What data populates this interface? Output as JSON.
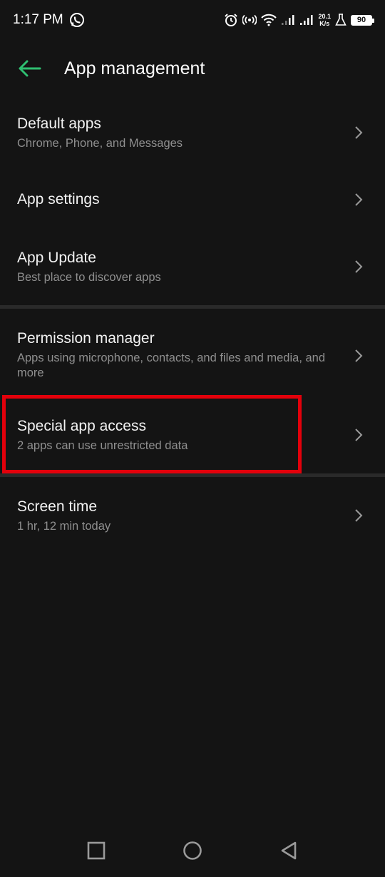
{
  "status_bar": {
    "time": "1:17 PM",
    "net_speed_value": "20.1",
    "net_speed_unit": "K/s",
    "battery": "90",
    "icons": [
      "whatsapp-icon",
      "alarm-icon",
      "hotspot-icon",
      "wifi-icon",
      "signal-icon",
      "signal-icon",
      "lab-icon",
      "battery-icon"
    ]
  },
  "header": {
    "title": "App management",
    "back_icon": "back-arrow-icon",
    "accent_color": "#2fbf71"
  },
  "items": [
    {
      "title": "Default apps",
      "subtitle": "Chrome, Phone, and Messages"
    },
    {
      "title": "App settings",
      "subtitle": ""
    },
    {
      "title": "App Update",
      "subtitle": "Best place to discover apps"
    },
    {
      "title": "Permission manager",
      "subtitle": "Apps using microphone, contacts, and files and media, and more"
    },
    {
      "title": "Special app access",
      "subtitle": "2 apps can use unrestricted data"
    },
    {
      "title": "Screen time",
      "subtitle": "1 hr, 12 min today"
    }
  ],
  "highlight": {
    "target": "Special app access",
    "color": "#e3000b"
  },
  "nav_bar": {
    "icons": [
      "recents-square-icon",
      "home-circle-icon",
      "back-triangle-icon"
    ]
  }
}
